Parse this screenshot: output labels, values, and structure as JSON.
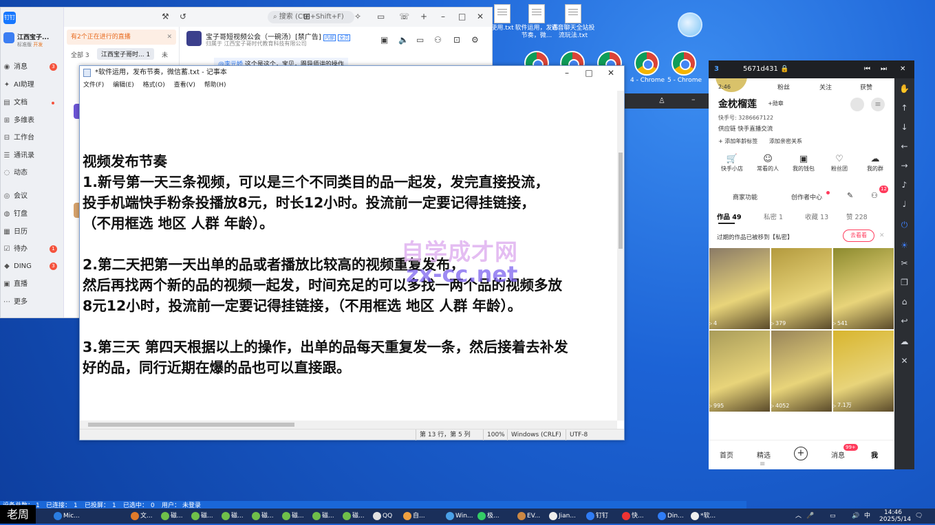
{
  "desktop": {
    "icons": [
      {
        "label": "使用.txt"
      },
      {
        "label": "软件运用，发布节奏，微..."
      },
      {
        "label": "语音聊天全站投流玩法.txt"
      }
    ],
    "chrome_labels": [
      "4 - Chrome",
      "5 - Chrome"
    ]
  },
  "dingtalk": {
    "logo": "钉钉",
    "user_name": "江西宝子...",
    "user_sub": "标准版",
    "user_tag": "开发",
    "nav": [
      {
        "icon": "chat-icon",
        "label": "消息",
        "badge": "3"
      },
      {
        "icon": "ai-icon",
        "label": "AI助理",
        "badge": ""
      },
      {
        "icon": "doc-icon",
        "label": "文档",
        "badge": "dot"
      },
      {
        "icon": "table-icon",
        "label": "多维表",
        "badge": ""
      },
      {
        "icon": "grid-icon",
        "label": "工作台",
        "badge": ""
      },
      {
        "icon": "contacts-icon",
        "label": "通讯录",
        "badge": ""
      },
      {
        "icon": "activity-icon",
        "label": "动态",
        "badge": ""
      },
      {
        "icon": "meeting-icon",
        "label": "会议",
        "badge": ""
      },
      {
        "icon": "disk-icon",
        "label": "钉盘",
        "badge": ""
      },
      {
        "icon": "calendar-icon",
        "label": "日历",
        "badge": ""
      },
      {
        "icon": "todo-icon",
        "label": "待办",
        "badge": "1"
      },
      {
        "icon": "ding-icon",
        "label": "DING",
        "badge": "3"
      },
      {
        "icon": "live-icon",
        "label": "直播",
        "badge": ""
      },
      {
        "icon": "more-icon",
        "label": "更多",
        "badge": ""
      }
    ],
    "search_placeholder": "搜索 (Ctrl+Shift+F)",
    "notice": "有2个正在进行的直播",
    "tabs": [
      "全部 3",
      "江西宝子哥时... 1",
      "未"
    ],
    "chat_title": "宝子哥短视频公会（一碗汤）[禁广告]",
    "chat_tag1": "内部",
    "chat_tag2": "全员",
    "chat_sub": "归属于 江西宝子哥时代教育科技有限公司",
    "chat_mention": "@李元娇",
    "chat_msg": "这个是这个，宝贝，跟导师讲的操作"
  },
  "notepad": {
    "title": "*软件运用，发布节奏，微信蓄.txt - 记事本",
    "menu": [
      "文件(F)",
      "编辑(E)",
      "格式(O)",
      "查看(V)",
      "帮助(H)"
    ],
    "content": "视频发布节奏\n1.新号第一天三条视频，可以是三个不同类目的品一起发，发完直接投流，\n投手机端快手粉条投播放8元，时长12小时。投流前一定要记得挂链接，\n（不用框选 地区 人群 年龄）。\n\n2.第二天把第一天出单的品或者播放比较高的视频重复发布，\n然后再找两个新的品的视频一起发，时间充足的可以多找一两个品的视频多放\n8元12小时，投流前一定要记得挂链接，（不用框选 地区 人群 年龄）。\n\n3.第三天 第四天根据以上的操作，出单的品每天重复发一条，然后接着去补发\n好的品，同行近期在爆的品也可以直接跟。",
    "status": {
      "pos": "第 13 行，第 5 列",
      "zoom": "100%",
      "eol": "Windows (CRLF)",
      "enc": "UTF-8"
    }
  },
  "watermark": {
    "line1": "自学成才网",
    "line2": "zx-cc.net"
  },
  "phone": {
    "device_no": "3",
    "device_id": "5671d431",
    "stats_time": "2:46",
    "stats_labels": [
      "粉丝",
      "关注",
      "获赞"
    ],
    "name": "金枕榴莲",
    "medal": "+勋章",
    "kuaishou_id": "快手号: 3286667122",
    "supply": "供应链 快手直播交流",
    "add_tag": "+ 添加年龄标签",
    "add_rel": "添加亲密关系",
    "features": [
      {
        "icon": "cart-icon",
        "label": "快手小店"
      },
      {
        "icon": "people-icon",
        "label": "常看的人"
      },
      {
        "icon": "wallet-icon",
        "label": "我的钱包"
      },
      {
        "icon": "fans-icon",
        "label": "粉丝团"
      },
      {
        "icon": "group-icon",
        "label": "我的群"
      }
    ],
    "merchant": "商家功能",
    "creator": "创作者中心",
    "follow_badge": "12",
    "tabs": [
      {
        "label": "作品 49",
        "active": true
      },
      {
        "label": "私密 1",
        "active": false
      },
      {
        "label": "收藏 13",
        "active": false
      },
      {
        "label": "赞 228",
        "active": false
      }
    ],
    "expired_note": "过期的作品已被移到【私密】",
    "view_btn": "去看看",
    "grid": [
      {
        "count": "4",
        "color": "#8a7a66"
      },
      {
        "count": "379",
        "color": "#b39a3e"
      },
      {
        "count": "541",
        "color": "#8c8a2e"
      },
      {
        "count": "995",
        "color": "#a99c5a"
      },
      {
        "count": "4052",
        "color": "#988459"
      },
      {
        "count": "7.1万",
        "color": "#d8b52e"
      }
    ],
    "bottom_nav": [
      "首页",
      "精选",
      "+",
      "消息",
      "我"
    ],
    "msg_badge": "99+"
  },
  "statusbar": {
    "left": "设备总数：",
    "total": "1",
    "connected_label": "已连接：",
    "connected": "1",
    "projected_label": "已投屏：",
    "projected": "1",
    "selected_label": "已选中：",
    "selected": "0",
    "user_label": "用户：",
    "user": "未登录"
  },
  "corner_label": "老周",
  "taskbar": {
    "items": [
      "Mic...",
      "文...",
      "磁...",
      "磁...",
      "磁...",
      "磁...",
      "磁...",
      "磁...",
      "磁...",
      "QQ",
      "自...",
      "Win...",
      "极...",
      "EV...",
      "Jian...",
      "钉钉",
      "快...",
      "Din...",
      "*软..."
    ],
    "clock_time": "14:46",
    "clock_date": "2025/5/14",
    "ime": "中"
  }
}
